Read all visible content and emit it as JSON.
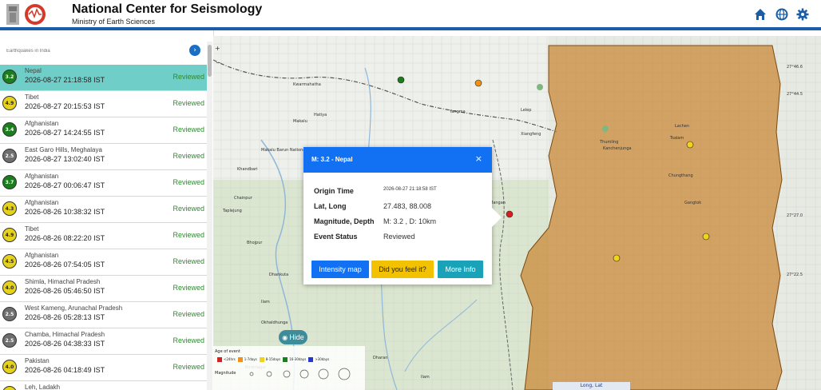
{
  "header": {
    "title": "National Center for Seismology",
    "subtitle": "Ministry of Earth Sciences",
    "icons": [
      "home-icon",
      "globe-icon",
      "gear-icon"
    ],
    "brand_color": "#1a5ea8"
  },
  "sidebar": {
    "search_placeholder": "Earthquakes in India",
    "events": [
      {
        "mag": "3.2",
        "place": "Nepal",
        "time": "2026-08-27 21:18:58 IST",
        "status": "Reviewed",
        "color": "#1b7d1b",
        "active": true
      },
      {
        "mag": "4.9",
        "place": "Tibet",
        "time": "2026-08-27 20:15:53 IST",
        "status": "Reviewed",
        "color": "#e6d21a"
      },
      {
        "mag": "3.4",
        "place": "Afghanistan",
        "time": "2026-08-27 14:24:55 IST",
        "status": "Reviewed",
        "color": "#1b7d1b"
      },
      {
        "mag": "2.5",
        "place": "East Garo Hills, Meghalaya",
        "time": "2026-08-27 13:02:40 IST",
        "status": "Reviewed",
        "color": "#6e6e6e"
      },
      {
        "mag": "3.7",
        "place": "Afghanistan",
        "time": "2026-08-27 00:06:47 IST",
        "status": "Reviewed",
        "color": "#1b7d1b"
      },
      {
        "mag": "4.3",
        "place": "Afghanistan",
        "time": "2026-08-26 10:38:32 IST",
        "status": "Reviewed",
        "color": "#e6d21a"
      },
      {
        "mag": "4.9",
        "place": "Tibet",
        "time": "2026-08-26 08:22:20 IST",
        "status": "Reviewed",
        "color": "#e6d21a"
      },
      {
        "mag": "4.5",
        "place": "Afghanistan",
        "time": "2026-08-26 07:54:05 IST",
        "status": "Reviewed",
        "color": "#e6d21a"
      },
      {
        "mag": "4.0",
        "place": "Shimla, Himachal Pradesh",
        "time": "2026-08-26 05:46:50 IST",
        "status": "Reviewed",
        "color": "#e6d21a"
      },
      {
        "mag": "2.5",
        "place": "West Kameng, Arunachal Pradesh",
        "time": "2026-08-26 05:28:13 IST",
        "status": "Reviewed",
        "color": "#6e6e6e"
      },
      {
        "mag": "2.5",
        "place": "Chamba, Himachal Pradesh",
        "time": "2026-08-26 04:38:33 IST",
        "status": "Reviewed",
        "color": "#6e6e6e"
      },
      {
        "mag": "4.0",
        "place": "Pakistan",
        "time": "2026-08-26 04:18:49 IST",
        "status": "Reviewed",
        "color": "#e6d21a"
      },
      {
        "mag": "",
        "place": "Leh, Ladakh",
        "time": "",
        "status": "",
        "color": "#e6d21a"
      }
    ]
  },
  "popup": {
    "title": "M: 3.2 - Nepal",
    "origin_time_label": "Origin Time",
    "origin_time": "2026-08-27 21:18:58 IST",
    "latlong_label": "Lat, Long",
    "latlong": "27.483, 88.008",
    "mag_depth_label": "Magnitude, Depth",
    "mag_depth": "M: 3.2 , D: 10km",
    "status_label": "Event Status",
    "status": "Reviewed",
    "buttons": [
      "Intensity map",
      "Did you feel it?",
      "More Info"
    ],
    "button_colors": [
      "#1271f2",
      "#f2c200",
      "#1aa3b8"
    ]
  },
  "map": {
    "hide_label": "Hide",
    "legend_age_title": "Age of event",
    "legend_ages": [
      {
        "label": "<24hrs",
        "color": "#d6201f"
      },
      {
        "label": "1-7days",
        "color": "#f0901a"
      },
      {
        "label": "8-15days",
        "color": "#f2d21a"
      },
      {
        "label": "16-30days",
        "color": "#1b7d1b"
      },
      {
        "label": ">30days",
        "color": "#2636c8"
      }
    ],
    "legend_mag_title": "Magnitude",
    "long_lat_label": "Long, Lat",
    "labels": [
      "Kwarmahatha",
      "Hatiya",
      "Makalu",
      "Makalu Barun National Park",
      "Yangma",
      "Lelep",
      "Xiangfeng",
      "Kanchenjunga",
      "Thumling",
      "Yuksom",
      "Lachen",
      "Tsalam",
      "Chungthang",
      "Pelling",
      "Khandbari",
      "Chainpur",
      "Gangtok",
      "Mangan",
      "Phidim",
      "Taplejung",
      "Bhojpur",
      "Dhankuta",
      "Ilam",
      "Pathibhara",
      "Okhaldhunga",
      "Biratnagar",
      "Dharan",
      "Ilam"
    ]
  }
}
